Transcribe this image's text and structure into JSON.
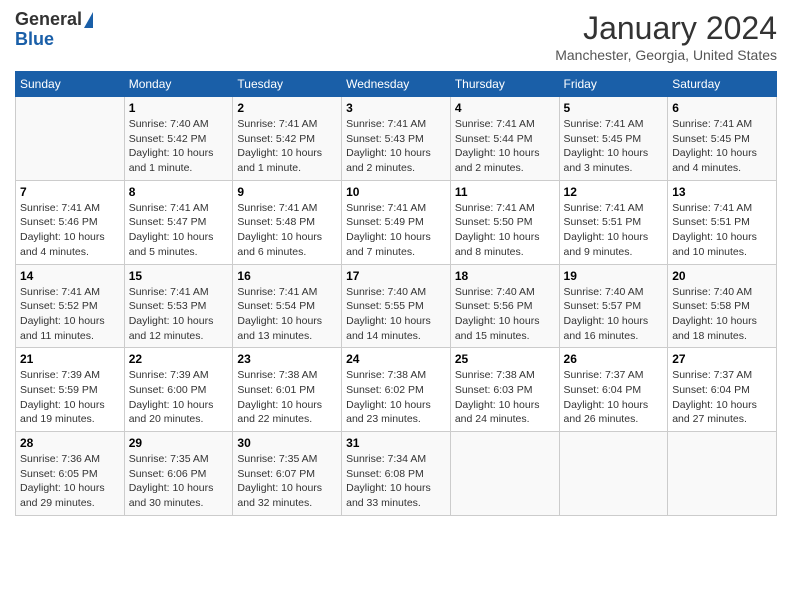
{
  "logo": {
    "line1": "General",
    "line2": "Blue"
  },
  "title": "January 2024",
  "location": "Manchester, Georgia, United States",
  "days_header": [
    "Sunday",
    "Monday",
    "Tuesday",
    "Wednesday",
    "Thursday",
    "Friday",
    "Saturday"
  ],
  "weeks": [
    [
      {
        "day": "",
        "info": ""
      },
      {
        "day": "1",
        "info": "Sunrise: 7:40 AM\nSunset: 5:42 PM\nDaylight: 10 hours\nand 1 minute."
      },
      {
        "day": "2",
        "info": "Sunrise: 7:41 AM\nSunset: 5:42 PM\nDaylight: 10 hours\nand 1 minute."
      },
      {
        "day": "3",
        "info": "Sunrise: 7:41 AM\nSunset: 5:43 PM\nDaylight: 10 hours\nand 2 minutes."
      },
      {
        "day": "4",
        "info": "Sunrise: 7:41 AM\nSunset: 5:44 PM\nDaylight: 10 hours\nand 2 minutes."
      },
      {
        "day": "5",
        "info": "Sunrise: 7:41 AM\nSunset: 5:45 PM\nDaylight: 10 hours\nand 3 minutes."
      },
      {
        "day": "6",
        "info": "Sunrise: 7:41 AM\nSunset: 5:45 PM\nDaylight: 10 hours\nand 4 minutes."
      }
    ],
    [
      {
        "day": "7",
        "info": "Sunrise: 7:41 AM\nSunset: 5:46 PM\nDaylight: 10 hours\nand 4 minutes."
      },
      {
        "day": "8",
        "info": "Sunrise: 7:41 AM\nSunset: 5:47 PM\nDaylight: 10 hours\nand 5 minutes."
      },
      {
        "day": "9",
        "info": "Sunrise: 7:41 AM\nSunset: 5:48 PM\nDaylight: 10 hours\nand 6 minutes."
      },
      {
        "day": "10",
        "info": "Sunrise: 7:41 AM\nSunset: 5:49 PM\nDaylight: 10 hours\nand 7 minutes."
      },
      {
        "day": "11",
        "info": "Sunrise: 7:41 AM\nSunset: 5:50 PM\nDaylight: 10 hours\nand 8 minutes."
      },
      {
        "day": "12",
        "info": "Sunrise: 7:41 AM\nSunset: 5:51 PM\nDaylight: 10 hours\nand 9 minutes."
      },
      {
        "day": "13",
        "info": "Sunrise: 7:41 AM\nSunset: 5:51 PM\nDaylight: 10 hours\nand 10 minutes."
      }
    ],
    [
      {
        "day": "14",
        "info": "Sunrise: 7:41 AM\nSunset: 5:52 PM\nDaylight: 10 hours\nand 11 minutes."
      },
      {
        "day": "15",
        "info": "Sunrise: 7:41 AM\nSunset: 5:53 PM\nDaylight: 10 hours\nand 12 minutes."
      },
      {
        "day": "16",
        "info": "Sunrise: 7:41 AM\nSunset: 5:54 PM\nDaylight: 10 hours\nand 13 minutes."
      },
      {
        "day": "17",
        "info": "Sunrise: 7:40 AM\nSunset: 5:55 PM\nDaylight: 10 hours\nand 14 minutes."
      },
      {
        "day": "18",
        "info": "Sunrise: 7:40 AM\nSunset: 5:56 PM\nDaylight: 10 hours\nand 15 minutes."
      },
      {
        "day": "19",
        "info": "Sunrise: 7:40 AM\nSunset: 5:57 PM\nDaylight: 10 hours\nand 16 minutes."
      },
      {
        "day": "20",
        "info": "Sunrise: 7:40 AM\nSunset: 5:58 PM\nDaylight: 10 hours\nand 18 minutes."
      }
    ],
    [
      {
        "day": "21",
        "info": "Sunrise: 7:39 AM\nSunset: 5:59 PM\nDaylight: 10 hours\nand 19 minutes."
      },
      {
        "day": "22",
        "info": "Sunrise: 7:39 AM\nSunset: 6:00 PM\nDaylight: 10 hours\nand 20 minutes."
      },
      {
        "day": "23",
        "info": "Sunrise: 7:38 AM\nSunset: 6:01 PM\nDaylight: 10 hours\nand 22 minutes."
      },
      {
        "day": "24",
        "info": "Sunrise: 7:38 AM\nSunset: 6:02 PM\nDaylight: 10 hours\nand 23 minutes."
      },
      {
        "day": "25",
        "info": "Sunrise: 7:38 AM\nSunset: 6:03 PM\nDaylight: 10 hours\nand 24 minutes."
      },
      {
        "day": "26",
        "info": "Sunrise: 7:37 AM\nSunset: 6:04 PM\nDaylight: 10 hours\nand 26 minutes."
      },
      {
        "day": "27",
        "info": "Sunrise: 7:37 AM\nSunset: 6:04 PM\nDaylight: 10 hours\nand 27 minutes."
      }
    ],
    [
      {
        "day": "28",
        "info": "Sunrise: 7:36 AM\nSunset: 6:05 PM\nDaylight: 10 hours\nand 29 minutes."
      },
      {
        "day": "29",
        "info": "Sunrise: 7:35 AM\nSunset: 6:06 PM\nDaylight: 10 hours\nand 30 minutes."
      },
      {
        "day": "30",
        "info": "Sunrise: 7:35 AM\nSunset: 6:07 PM\nDaylight: 10 hours\nand 32 minutes."
      },
      {
        "day": "31",
        "info": "Sunrise: 7:34 AM\nSunset: 6:08 PM\nDaylight: 10 hours\nand 33 minutes."
      },
      {
        "day": "",
        "info": ""
      },
      {
        "day": "",
        "info": ""
      },
      {
        "day": "",
        "info": ""
      }
    ]
  ]
}
